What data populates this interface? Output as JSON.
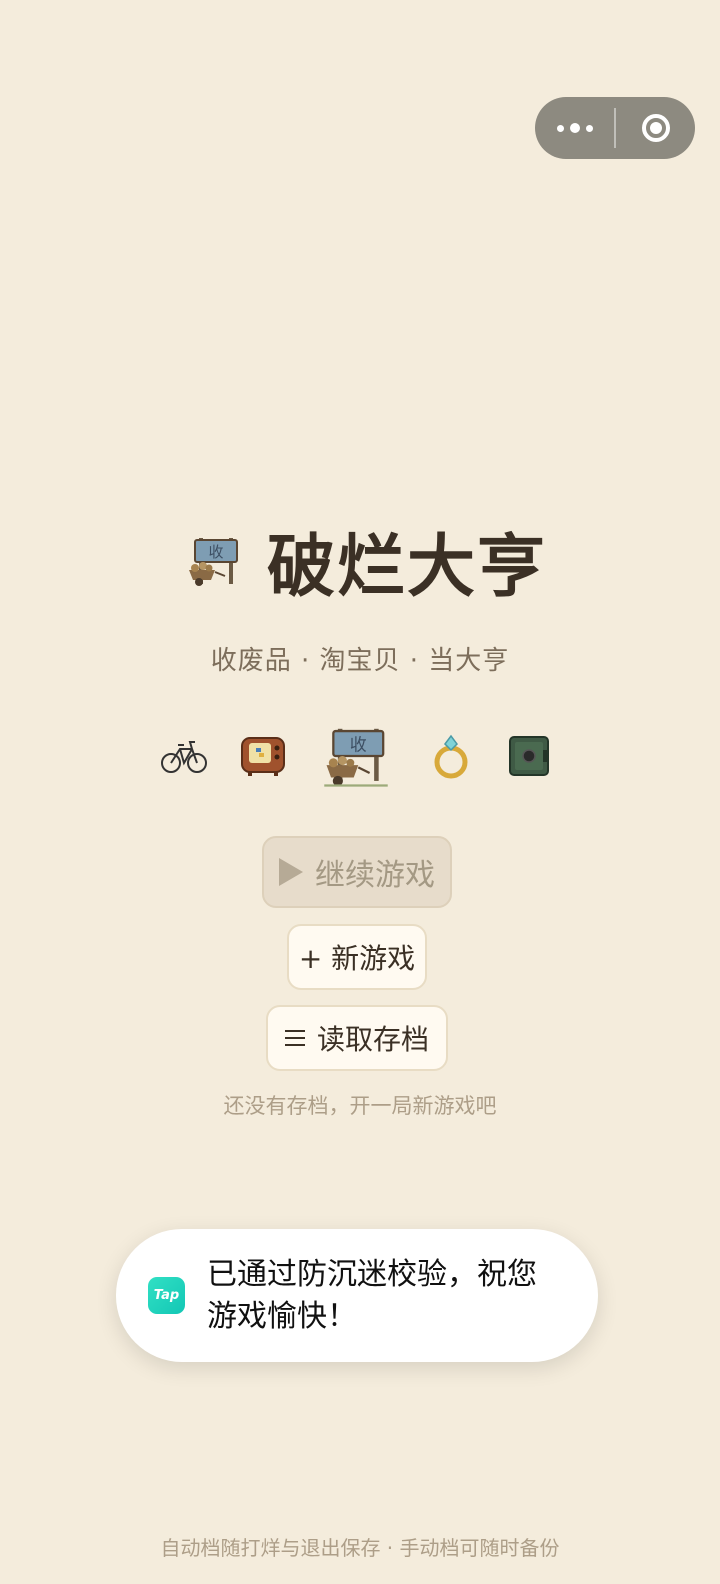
{
  "capsule": {
    "more_icon": "more-dots-icon",
    "close_icon": "target-close-icon"
  },
  "title": "破烂大亨",
  "subtitle": "收废品 · 淘宝贝 · 当大亨",
  "icons": [
    "bicycle-icon",
    "tv-icon",
    "cart-sign-icon",
    "ring-icon",
    "safe-icon"
  ],
  "buttons": {
    "continue_label": "继续游戏",
    "new_label": "+ 新游戏",
    "load_label": "读取存档"
  },
  "hint": "还没有存档，开一局新游戏吧",
  "toast": {
    "logo_text": "Tap",
    "message": "已通过防沉迷校验，祝您游戏愉快！"
  },
  "footer": "自动档随打烊与退出保存 · 手动档可随时备份",
  "colors": {
    "background": "#f4ecdc",
    "title": "#3b3025",
    "muted": "#ad9e88",
    "tap_brand": "#19cdb8"
  }
}
